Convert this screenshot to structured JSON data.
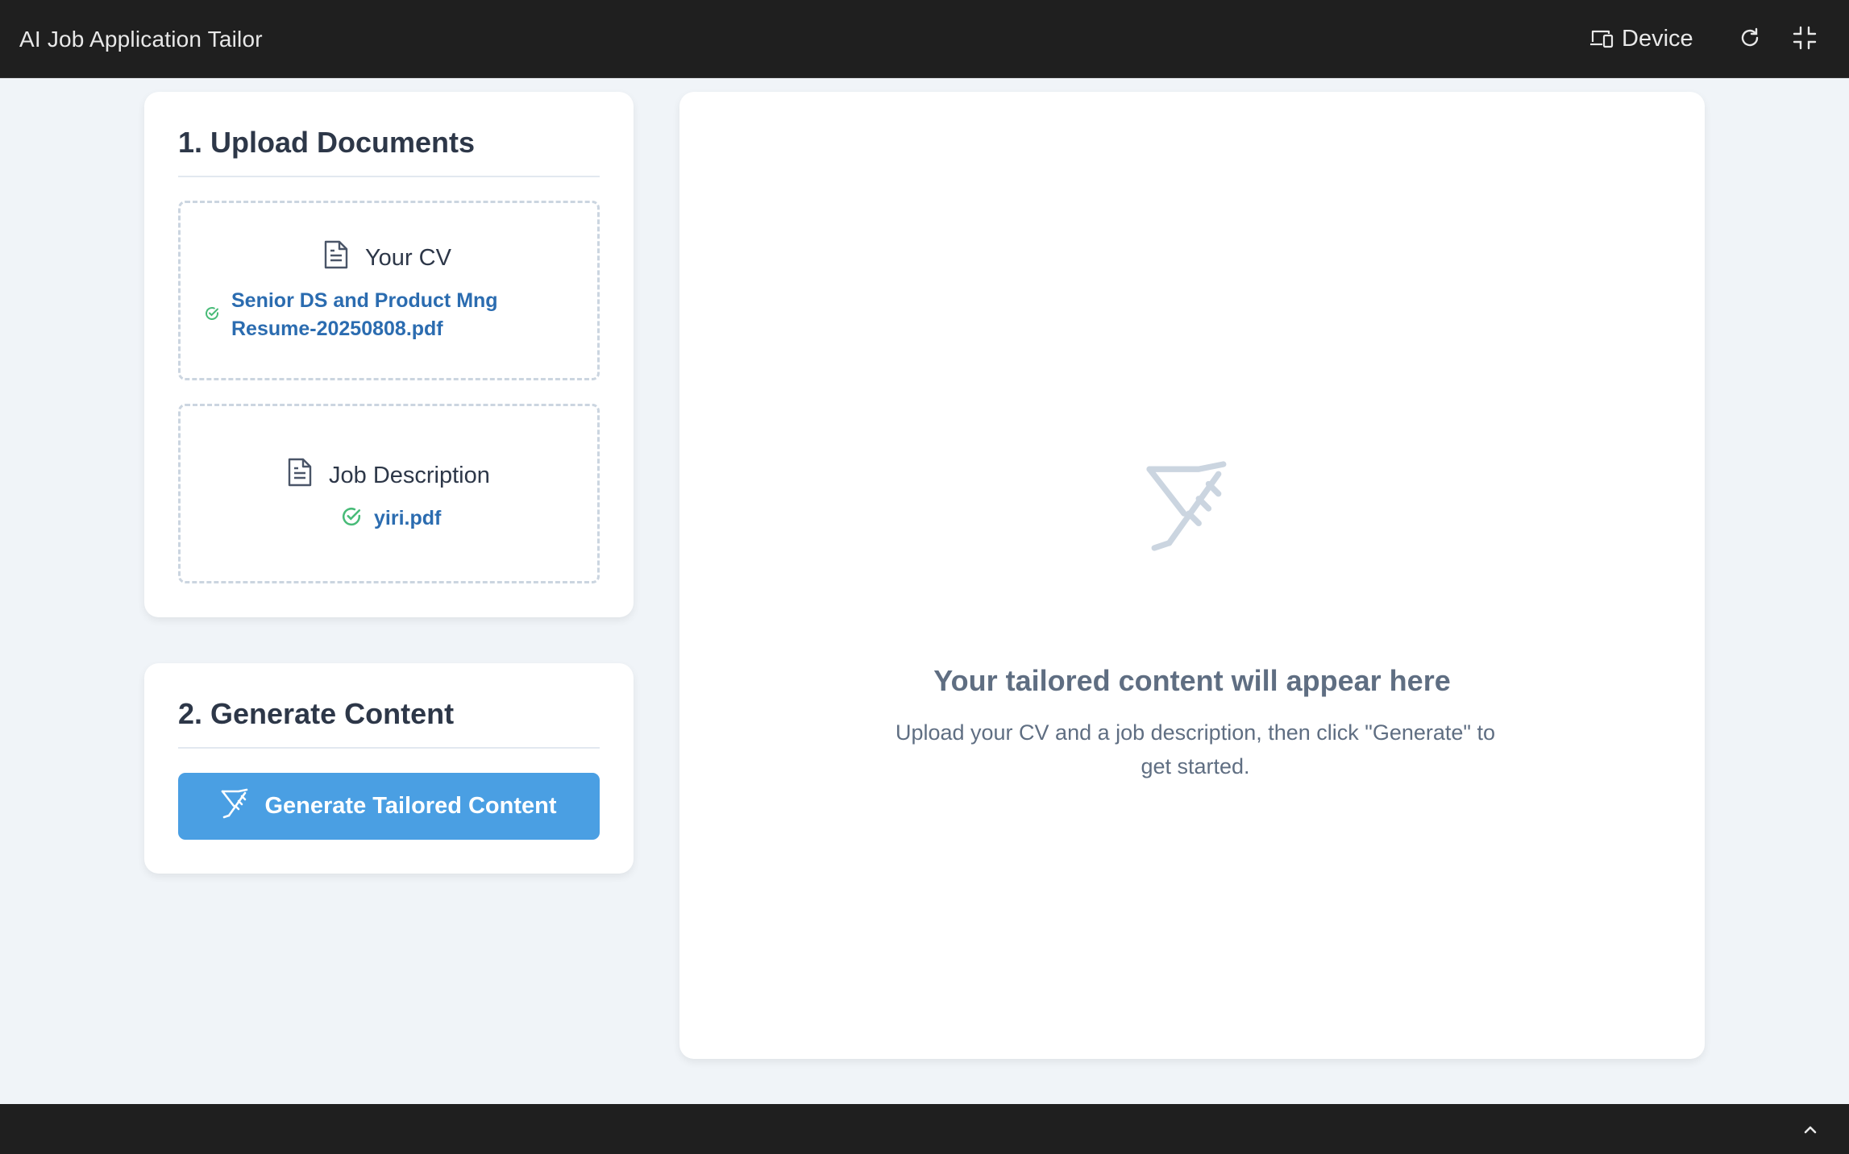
{
  "app": {
    "title": "AI Job Application Tailor"
  },
  "toolbar": {
    "device_label": "Device",
    "icons": [
      "device-icon",
      "refresh-icon",
      "exit-fullscreen-icon"
    ]
  },
  "upload": {
    "title": "1. Upload Documents",
    "cv": {
      "label": "Your CV",
      "file_line1": "Senior DS and Product Mng",
      "file_line2": "Resume-20250808.pdf",
      "status": "uploaded"
    },
    "job": {
      "label": "Job Description",
      "file": "yiri.pdf",
      "status": "uploaded"
    }
  },
  "generate": {
    "title": "2. Generate Content",
    "button_label": "Generate Tailored Content"
  },
  "output": {
    "placeholder_title": "Your tailored content will appear here",
    "placeholder_text": "Upload your CV and a job description, then click \"Generate\" to get started."
  },
  "colors": {
    "topbar": "#1f1f1f",
    "background": "#f0f4f8",
    "accent": "#4a9fe3",
    "file_link": "#2b6cb0",
    "success": "#48bb78",
    "muted": "#5f6e82"
  }
}
